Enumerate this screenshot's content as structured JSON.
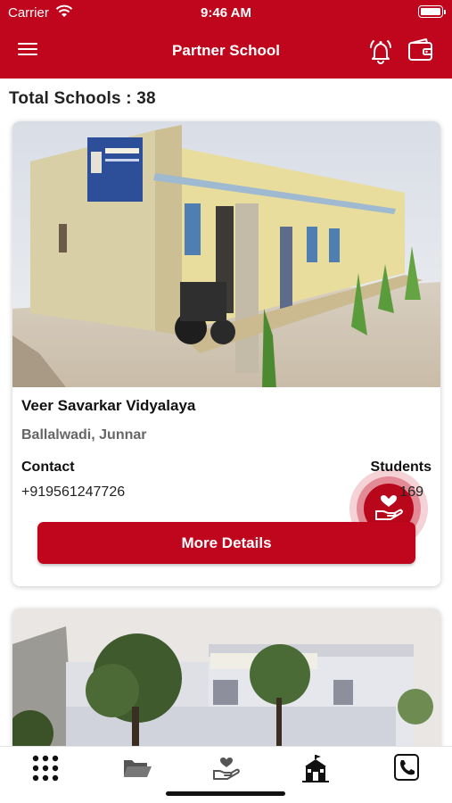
{
  "status_bar": {
    "carrier": "Carrier",
    "time": "9:46 AM"
  },
  "header": {
    "title": "Partner School",
    "icons": [
      "menu-icon",
      "bell-icon",
      "wallet-icon"
    ]
  },
  "summary": {
    "total_label": "Total Schools :  38"
  },
  "schools": [
    {
      "name": "Veer Savarkar Vidyalaya",
      "location": "Ballalwadi, Junnar",
      "contact_label": "Contact",
      "contact_value": "+919561247726",
      "students_label": "Students",
      "students_value": "169",
      "button_label": "More Details"
    }
  ],
  "tabbar": {
    "items": [
      "dashboard-grid-icon",
      "folder-icon",
      "donate-hand-icon",
      "school-building-icon",
      "phone-icon"
    ]
  },
  "colors": {
    "brand": "#c0061d",
    "background": "#ffffff",
    "muted_text": "#666666"
  }
}
